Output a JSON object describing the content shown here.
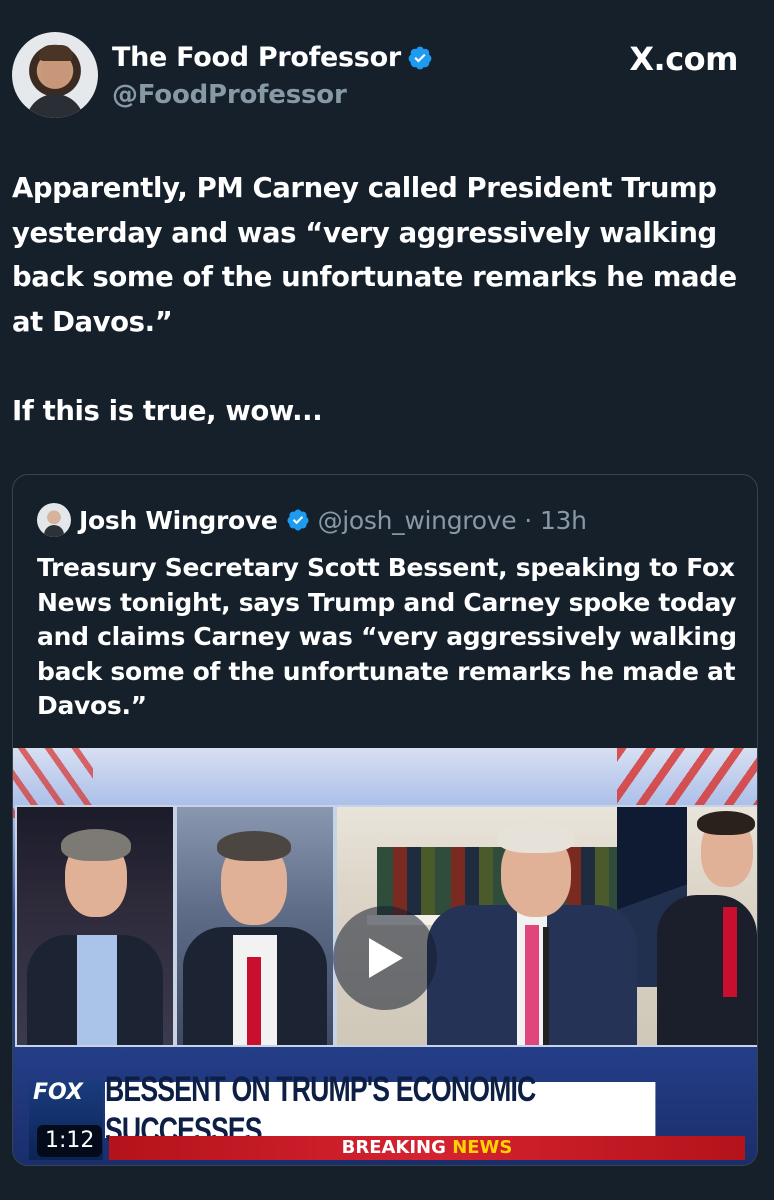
{
  "site": "X.com",
  "author": {
    "display_name": "The Food Professor",
    "handle": "@FoodProfessor",
    "verified": true
  },
  "tweet": {
    "text": "Apparently, PM Carney called President Trump yesterday and was “very aggressively walking back some of the unfortunate remarks he made at Davos.”\n\nIf this is true, wow..."
  },
  "quoted_tweet": {
    "display_name": "Josh Wingrove",
    "handle": "@josh_wingrove",
    "separator": "·",
    "time": "13h",
    "verified": true,
    "text": "Treasury Secretary Scott Bessent, speaking to Fox News tonight, says Trump and Carney spoke today and claims Carney was “very aggressively walking back some of the unfortunate remarks he made at Davos.”",
    "video": {
      "duration": "1:12",
      "chyron": "BESSENT ON TRUMP'S ECONOMIC SUCCESSES",
      "banner_breaking": "BREAKING",
      "banner_news": "NEWS",
      "network_logo": "FOX"
    }
  },
  "colors": {
    "background": "#15202b",
    "verified_badge": "#1d9bf0",
    "secondary_text": "#8899a6"
  }
}
